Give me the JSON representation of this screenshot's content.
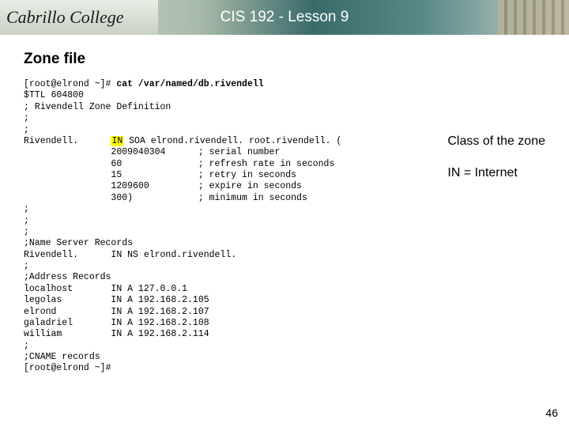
{
  "header": {
    "logo_text": "Cabrillo College",
    "title": "CIS 192 - Lesson 9"
  },
  "section": {
    "title": "Zone file"
  },
  "term": {
    "prompt1": "[root@elrond ~]# ",
    "cmd": "cat /var/named/db.rivendell",
    "ttl": "$TTL 604800",
    "comment_def": "; Rivendell Zone Definition",
    "sc1": ";",
    "sc2": ";",
    "origin": "Rivendell.",
    "in": "IN",
    "soa_rest": " SOA elrond.rivendell. root.rivendell. (",
    "serial": "                2009040304      ; serial number",
    "refresh": "                60              ; refresh rate in seconds",
    "retry": "                15              ; retry in seconds",
    "expire": "                1209600         ; expire in seconds",
    "minimum": "                300)            ; minimum in seconds",
    "sc3": ";",
    "sc4": ";",
    "sc5": ";",
    "ns_comment": ";Name Server Records",
    "ns_rec": "Rivendell.      IN NS elrond.rivendell.",
    "sc6": ";",
    "addr_comment": ";Address Records",
    "a_localhost": "localhost       IN A 127.0.0.1",
    "a_legolas": "legolas         IN A 192.168.2.105",
    "a_elrond": "elrond          IN A 192.168.2.107",
    "a_galadriel": "galadriel       IN A 192.168.2.108",
    "a_william": "william         IN A 192.168.2.114",
    "sc7": ";",
    "cname_comment": ";CNAME records",
    "prompt2": "[root@elrond ~]#"
  },
  "annotations": {
    "line1": "Class of the zone",
    "line2": "IN = Internet"
  },
  "page_number": "46"
}
